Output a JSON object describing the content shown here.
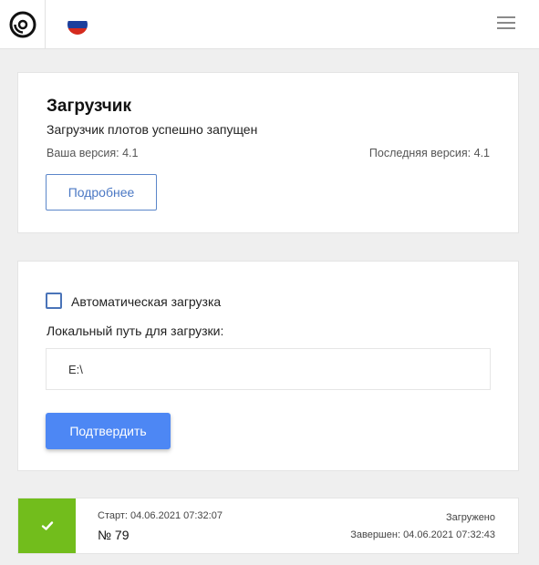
{
  "header": {
    "logo_icon": "disc-icon",
    "language_icon": "russian-flag-icon",
    "language_flag_colors": [
      "#ffffff",
      "#1c3f9c",
      "#d52b1e"
    ],
    "menu_icon": "hamburger-menu-icon"
  },
  "loader_card": {
    "title": "Загрузчик",
    "subtitle": "Загрузчик плотов успешно запущен",
    "your_version": "Ваша версия: 4.1",
    "latest_version": "Последняя версия: 4.1",
    "more_button": "Подробнее"
  },
  "settings_card": {
    "auto_download_label": "Автоматическая загрузка",
    "auto_download_checked": false,
    "path_label": "Локальный путь для загрузки:",
    "path_value": "E:\\",
    "confirm_button": "Подтвердить"
  },
  "jobs": [
    {
      "status_icon": "checkmark-icon",
      "status_color": "#72bd1c",
      "start": "Старт: 04.06.2021 07:32:07",
      "number": "№ 79",
      "status": "Загружено",
      "finished": "Завершен: 04.06.2021 07:32:43"
    }
  ],
  "colors": {
    "accent": "#4d87f4",
    "outline_button": "#4b78c4",
    "success": "#72bd1c",
    "background": "#efefef"
  }
}
